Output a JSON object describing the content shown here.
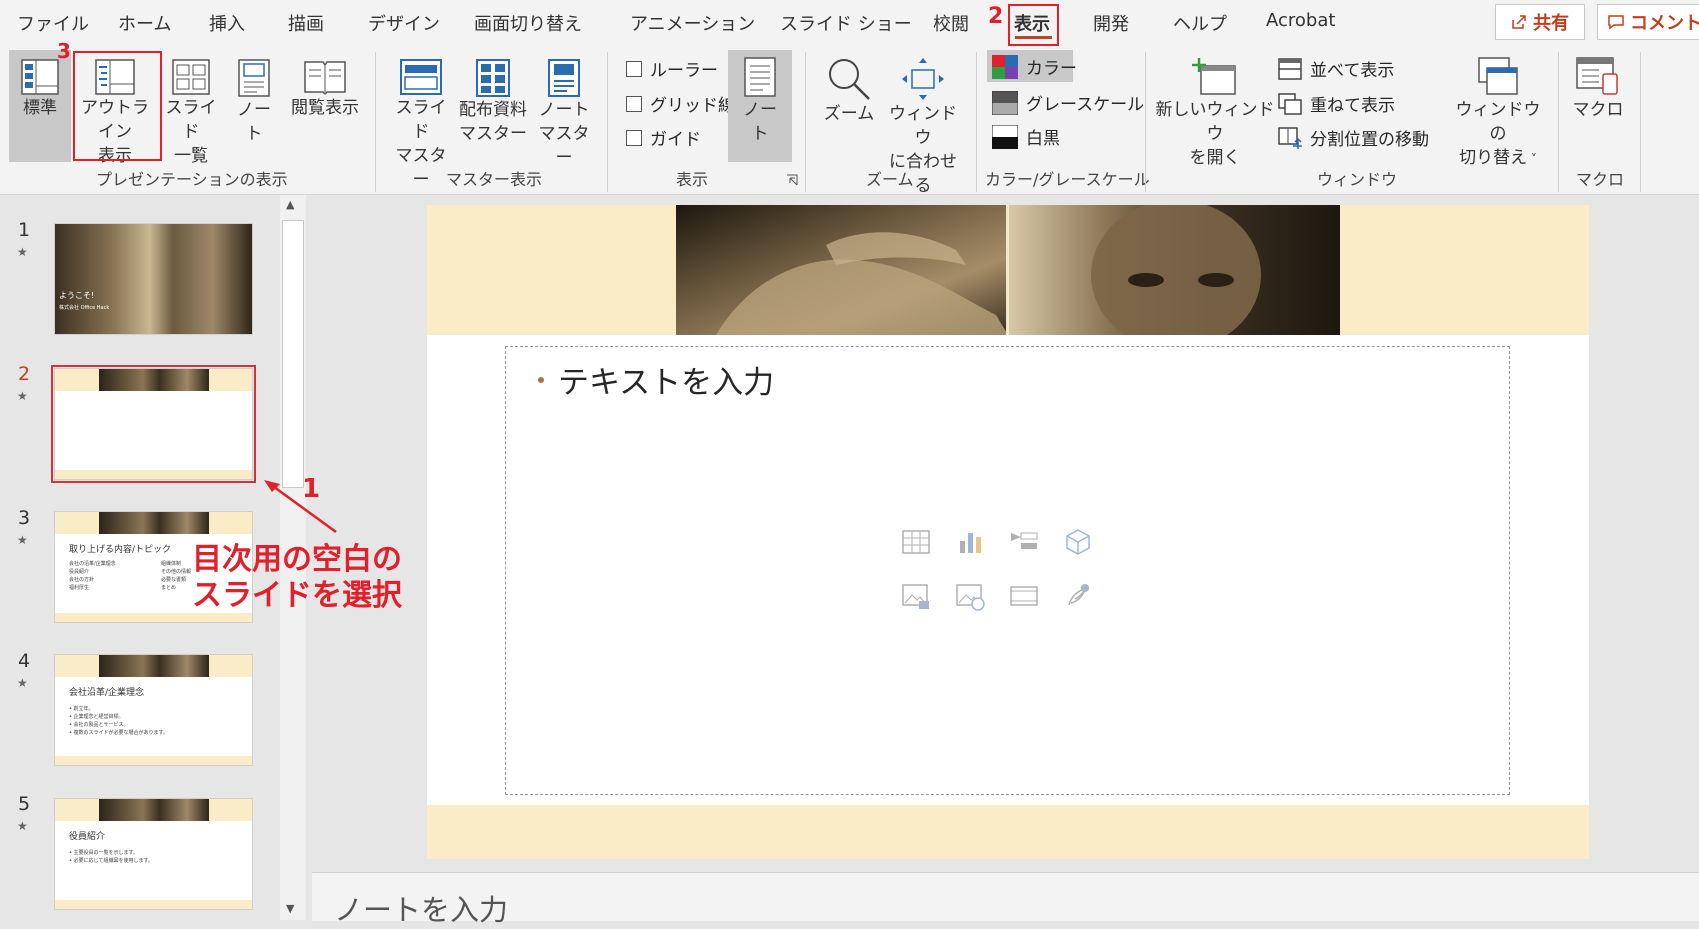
{
  "tabs": [
    "ファイル",
    "ホーム",
    "挿入",
    "描画",
    "デザイン",
    "画面切り替え",
    "アニメーション",
    "スライド ショー",
    "校閲",
    "表示",
    "開発",
    "ヘルプ",
    "Acrobat"
  ],
  "active_tab": "表示",
  "share_label": "共有",
  "comment_label": "コメント",
  "ribbon": {
    "presentation_views": {
      "label": "プレゼンテーションの表示",
      "normal": "標準",
      "outline": [
        "アウトライン",
        "表示"
      ],
      "sorter": [
        "スライド",
        "一覧"
      ],
      "notes": [
        "ノー",
        "ト"
      ],
      "reading": "閲覧表示"
    },
    "master_views": {
      "label": "マスター表示",
      "slide_master": [
        "スライド",
        "マスター"
      ],
      "handout_master": [
        "配布資料",
        "マスター"
      ],
      "notes_master": [
        "ノート",
        "マスター"
      ]
    },
    "show": {
      "label": "表示",
      "ruler": "ルーラー",
      "gridlines": "グリッド線",
      "guides": "ガイド",
      "notes": [
        "ノー",
        "ト"
      ]
    },
    "zoom": {
      "label": "ズーム",
      "zoom": "ズーム",
      "fit": [
        "ウィンドウ",
        "に合わせる"
      ]
    },
    "color": {
      "label": "カラー/グレースケール",
      "color": "カラー",
      "grayscale": "グレースケール",
      "bw": "白黒"
    },
    "window": {
      "label": "ウィンドウ",
      "new_window": [
        "新しいウィンドウ",
        "を開く"
      ],
      "arrange_all": "並べて表示",
      "cascade": "重ねて表示",
      "move_split": "分割位置の移動",
      "switch": [
        "ウィンドウの",
        "切り替え"
      ]
    },
    "macros": {
      "label": "マクロ",
      "macros": "マクロ"
    }
  },
  "slides": [
    {
      "num": "1",
      "title": "ようこそ!",
      "sub": "株式会社 Office Hack"
    },
    {
      "num": "2",
      "title": ""
    },
    {
      "num": "3",
      "title": "取り上げる内容/トピック",
      "bullets_left": [
        "会社の沿革/企業理念",
        "役員紹介",
        "会社の方針",
        "福利厚生"
      ],
      "bullets_right": [
        "組織体制",
        "その他の情報",
        "必要な書類",
        "まとめ"
      ]
    },
    {
      "num": "4",
      "title": "会社沿革/企業理念",
      "bullets": [
        "• 創立年。",
        "• 企業理念と経営目標。",
        "• 会社の製品とサービス。",
        "• 複数のスライドが必要な場合があります。"
      ]
    },
    {
      "num": "5",
      "title": "役員紹介",
      "bullets": [
        "• 主要役員の一覧を示します。",
        "• 必要に応じて組織図を使用します。"
      ]
    }
  ],
  "slide_body_placeholder": "テキストを入力",
  "notes_placeholder": "ノートを入力",
  "annotations": {
    "num1": "1",
    "num2": "2",
    "num3": "3",
    "text1": [
      "目次用の空白の",
      "スライドを選択"
    ]
  }
}
